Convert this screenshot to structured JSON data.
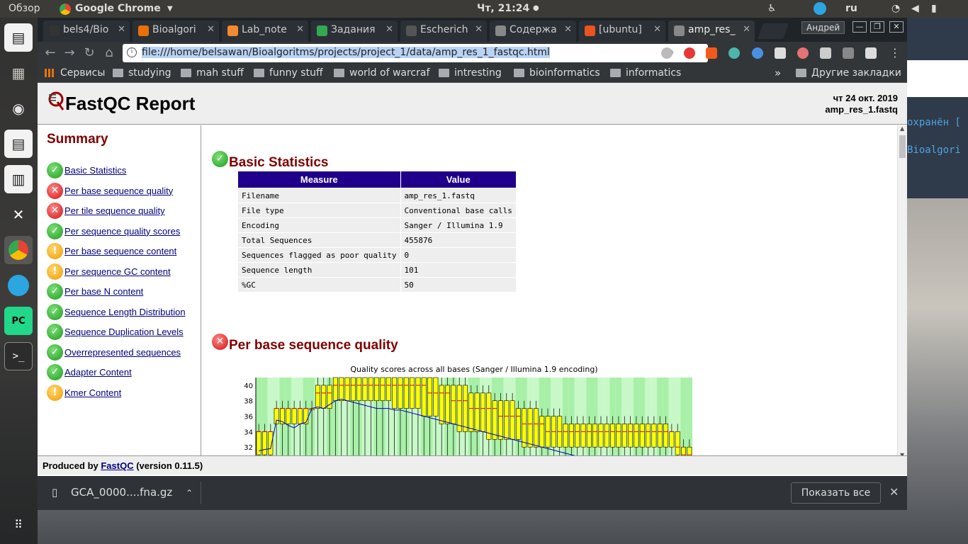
{
  "topbar": {
    "activities": "Обзор",
    "app": "Google Chrome",
    "clock": "Чт, 21:24",
    "lang": "ru"
  },
  "launcher": {
    "icons": [
      "libreoffice-writer-icon",
      "files-icon",
      "firefox-icon",
      "libreoffice-writer-icon",
      "libreoffice-calc-icon",
      "system-settings-icon",
      "chrome-icon",
      "telegram-icon",
      "pycharm-icon",
      "terminal-icon",
      "app-grid-icon"
    ]
  },
  "terminal": {
    "line1": "охранён [",
    "line2": "Bioalgori"
  },
  "tabs": [
    {
      "label": "bels4/Bio",
      "color": "#333"
    },
    {
      "label": "Bioalgori",
      "color": "#e8710a"
    },
    {
      "label": "Lab_note",
      "color": "#f28b30"
    },
    {
      "label": "Задания",
      "color": "#34a853"
    },
    {
      "label": "Escherich",
      "color": "#555"
    },
    {
      "label": "Содержа",
      "color": "#888"
    },
    {
      "label": "[ubuntu]",
      "color": "#e95420"
    },
    {
      "label": "amp_res_",
      "color": "#888"
    }
  ],
  "user": "Андрей",
  "address": "file:///home/belsawan/Bioalgoritms/projects/project_1/data/amp_res_1_fastqc.html",
  "bookmarks": [
    "Сервисы",
    "studying",
    "mah stuff",
    "funny stuff",
    "world of warcraf",
    "intresting",
    "bioinformatics",
    "informatics",
    "Другие закладки"
  ],
  "report": {
    "title": "FastQC Report",
    "date": "чт 24 окт. 2019",
    "file": "amp_res_1.fastq",
    "summary_title": "Summary",
    "summary": [
      {
        "label": "Basic Statistics",
        "status": "pass"
      },
      {
        "label": "Per base sequence quality",
        "status": "fail"
      },
      {
        "label": "Per tile sequence quality",
        "status": "fail"
      },
      {
        "label": "Per sequence quality scores",
        "status": "pass"
      },
      {
        "label": "Per base sequence content",
        "status": "warn"
      },
      {
        "label": "Per sequence GC content",
        "status": "warn"
      },
      {
        "label": "Per base N content",
        "status": "pass"
      },
      {
        "label": "Sequence Length Distribution",
        "status": "pass"
      },
      {
        "label": "Sequence Duplication Levels",
        "status": "pass"
      },
      {
        "label": "Overrepresented sequences",
        "status": "pass"
      },
      {
        "label": "Adapter Content",
        "status": "pass"
      },
      {
        "label": "Kmer Content",
        "status": "warn"
      }
    ],
    "basic_title": "Basic Statistics",
    "stats_headers": [
      "Measure",
      "Value"
    ],
    "stats": [
      [
        "Filename",
        "amp_res_1.fastq"
      ],
      [
        "File type",
        "Conventional base calls"
      ],
      [
        "Encoding",
        "Sanger / Illumina 1.9"
      ],
      [
        "Total Sequences",
        "455876"
      ],
      [
        "Sequences flagged as poor quality",
        "0"
      ],
      [
        "Sequence length",
        "101"
      ],
      [
        "%GC",
        "50"
      ]
    ],
    "pbsq_title": "Per base sequence quality",
    "footer_pre": "Produced by ",
    "footer_link": "FastQC",
    "footer_post": " (version 0.11.5)"
  },
  "chart_data": {
    "type": "box",
    "title": "Quality scores across all bases (Sanger / Illumina 1.9 encoding)",
    "yticks": [
      32,
      34,
      36,
      38,
      40
    ],
    "ylim": [
      30,
      41
    ],
    "median": [
      34,
      34,
      34,
      37,
      37,
      37,
      37,
      37,
      37,
      37,
      39,
      39,
      39,
      40,
      40,
      40,
      40,
      40,
      40,
      40,
      40,
      40,
      40,
      40,
      40,
      40,
      40,
      40,
      40,
      39,
      39,
      39,
      39,
      38,
      38,
      38,
      37,
      37,
      37,
      37,
      37,
      36,
      36,
      36,
      36,
      35,
      35,
      35,
      35,
      34,
      34,
      34,
      34,
      34,
      34,
      34,
      34,
      34,
      34,
      34,
      34,
      34,
      34,
      34,
      34,
      34,
      34,
      34,
      34,
      34,
      34,
      32,
      31,
      31
    ],
    "q1": [
      31,
      31,
      31,
      35,
      35,
      35,
      35,
      35,
      35,
      37,
      37,
      37,
      37,
      38,
      38,
      38,
      38,
      38,
      38,
      38,
      38,
      38,
      38,
      37,
      37,
      37,
      37,
      37,
      36,
      36,
      36,
      35,
      35,
      35,
      34,
      34,
      34,
      34,
      34,
      33,
      33,
      33,
      33,
      33,
      33,
      32,
      32,
      32,
      32,
      32,
      32,
      32,
      32,
      32,
      32,
      32,
      32,
      32,
      32,
      32,
      32,
      32,
      32,
      32,
      32,
      32,
      32,
      32,
      32,
      32,
      32,
      31,
      30,
      30
    ],
    "q3": [
      34,
      34,
      34,
      37,
      37,
      37,
      37,
      37,
      37,
      37,
      40,
      40,
      40,
      41,
      41,
      41,
      41,
      41,
      41,
      41,
      41,
      41,
      41,
      41,
      41,
      41,
      41,
      41,
      41,
      41,
      41,
      40,
      40,
      40,
      40,
      40,
      39,
      39,
      39,
      39,
      38,
      38,
      38,
      38,
      37,
      37,
      37,
      37,
      36,
      36,
      36,
      36,
      35,
      35,
      35,
      35,
      35,
      35,
      35,
      35,
      35,
      35,
      35,
      35,
      35,
      35,
      35,
      35,
      35,
      35,
      34,
      34,
      32,
      32
    ],
    "mean": [
      31.5,
      31.7,
      31.8,
      35.5,
      35.3,
      34.8,
      34.5,
      35.0,
      35.2,
      37.0,
      37.2,
      37.0,
      37.5,
      38.0,
      38.2,
      38.0,
      37.8,
      37.6,
      37.4,
      37.2,
      37.0,
      37.0,
      37.0,
      36.8,
      36.8,
      36.6,
      36.4,
      36.2,
      36.0,
      35.8,
      35.6,
      35.4,
      35.2,
      35.0,
      34.8,
      34.6,
      34.4,
      34.2,
      34.0,
      33.8,
      33.6,
      33.4,
      33.2,
      33.0,
      32.8,
      32.6,
      32.4,
      32.2,
      32.0,
      31.8,
      31.6,
      31.4,
      31.2,
      31.0,
      30.8,
      30.6,
      30.4,
      30.2,
      30.0,
      30.0,
      30.0,
      30.0,
      30.0,
      30.0,
      30.0,
      30.0,
      30.0,
      30.0,
      30.0,
      30.0,
      30.0,
      30.0,
      30.0,
      30.0
    ]
  },
  "download": {
    "file": "GCA_0000....fna.gz",
    "show_all": "Показать все"
  }
}
